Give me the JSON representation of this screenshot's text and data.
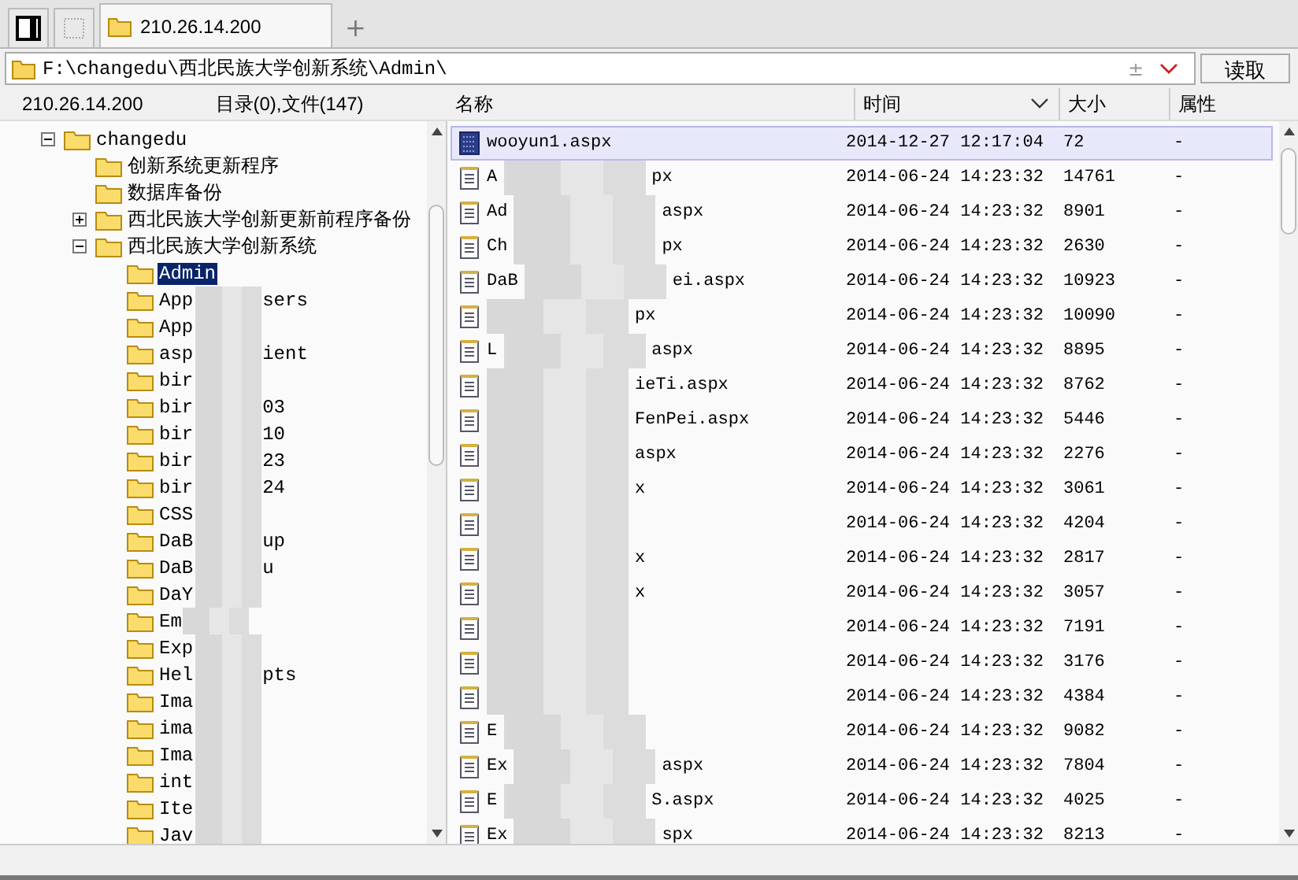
{
  "tabs": [
    {
      "kind": "panel",
      "selected": false
    },
    {
      "kind": "blank",
      "selected": false
    },
    {
      "kind": "folder",
      "label": "210.26.14.200",
      "selected": true
    }
  ],
  "new_tab": "+",
  "address": {
    "value": "F:\\changedu\\西北民族大学创新系统\\Admin\\",
    "extra": "±",
    "button": "读取"
  },
  "left_header": {
    "host": "210.26.14.200",
    "summary": "目录(0),文件(147)"
  },
  "columns": [
    {
      "label": "名称",
      "sorted": false
    },
    {
      "label": "时间",
      "sorted": true
    },
    {
      "label": "大小",
      "sorted": false
    },
    {
      "label": "属性",
      "sorted": false
    }
  ],
  "tree": [
    {
      "name": "changedu",
      "selected": false,
      "expanded": true,
      "children": [
        {
          "name": "创新系统更新程序",
          "selected": false
        },
        {
          "name": "数据库备份",
          "selected": false
        },
        {
          "name": "西北民族大学创新更新前程序备份",
          "selected": false,
          "expanded": false
        },
        {
          "name": "西北民族大学创新系统",
          "selected": false,
          "expanded": true,
          "children": [
            {
              "name": "Admin",
              "selected": true,
              "redacted": false
            },
            {
              "name": "App",
              "name_end": "sers",
              "selected": false,
              "redacted": true
            },
            {
              "name": "App",
              "selected": false,
              "redacted": true
            },
            {
              "name": "asp",
              "name_end": "ient",
              "selected": false,
              "redacted": true
            },
            {
              "name": "bir",
              "selected": false,
              "redacted": true
            },
            {
              "name": "bir",
              "name_end": "03",
              "selected": false,
              "redacted": true
            },
            {
              "name": "bir",
              "name_end": "10",
              "selected": false,
              "redacted": true
            },
            {
              "name": "bir",
              "name_end": "23",
              "selected": false,
              "redacted": true
            },
            {
              "name": "bir",
              "name_end": "24",
              "selected": false,
              "redacted": true
            },
            {
              "name": "CSS",
              "selected": false,
              "redacted": true
            },
            {
              "name": "DaB",
              "name_end": "up",
              "selected": false,
              "redacted": true
            },
            {
              "name": "DaB",
              "name_end": "u",
              "selected": false,
              "redacted": true
            },
            {
              "name": "DaY",
              "selected": false,
              "redacted": true
            },
            {
              "name": "Em",
              "selected": false,
              "redacted": true
            },
            {
              "name": "Exp",
              "selected": false,
              "redacted": true
            },
            {
              "name": "Hel",
              "name_end": "pts",
              "selected": false,
              "redacted": true
            },
            {
              "name": "Ima",
              "selected": false,
              "redacted": true
            },
            {
              "name": "ima",
              "selected": false,
              "redacted": true
            },
            {
              "name": "Ima",
              "selected": false,
              "redacted": true
            },
            {
              "name": "int",
              "selected": false,
              "redacted": true
            },
            {
              "name": "Ite",
              "selected": false,
              "redacted": true
            },
            {
              "name": "Jav",
              "selected": false,
              "redacted": true
            }
          ]
        }
      ]
    }
  ],
  "files": [
    {
      "kind": "special",
      "name": "wooyun1.aspx",
      "redacted": false,
      "selected": true,
      "time": "2014-12-27 12:17:04",
      "size": "72",
      "attr": "-"
    },
    {
      "kind": "text",
      "name": "A",
      "name_end": "px",
      "redacted": true,
      "selected": false,
      "time": "2014-06-24 14:23:32",
      "size": "14761",
      "attr": "-"
    },
    {
      "kind": "text",
      "name": "Ad",
      "name_end": "aspx",
      "redacted": true,
      "selected": false,
      "time": "2014-06-24 14:23:32",
      "size": "8901",
      "attr": "-"
    },
    {
      "kind": "text",
      "name": "Ch",
      "name_end": "px",
      "redacted": true,
      "selected": false,
      "time": "2014-06-24 14:23:32",
      "size": "2630",
      "attr": "-"
    },
    {
      "kind": "text",
      "name": "DaB",
      "name_end": "ei.aspx",
      "redacted": true,
      "selected": false,
      "time": "2014-06-24 14:23:32",
      "size": "10923",
      "attr": "-"
    },
    {
      "kind": "text",
      "name_end": "px",
      "redacted": true,
      "selected": false,
      "time": "2014-06-24 14:23:32",
      "size": "10090",
      "attr": "-"
    },
    {
      "kind": "text",
      "name": "L",
      "name_end": "aspx",
      "redacted": true,
      "selected": false,
      "time": "2014-06-24 14:23:32",
      "size": "8895",
      "attr": "-"
    },
    {
      "kind": "text",
      "name_end": "ieTi.aspx",
      "redacted": true,
      "selected": false,
      "time": "2014-06-24 14:23:32",
      "size": "8762",
      "attr": "-"
    },
    {
      "kind": "text",
      "name_end": "FenPei.aspx",
      "redacted": true,
      "selected": false,
      "time": "2014-06-24 14:23:32",
      "size": "5446",
      "attr": "-"
    },
    {
      "kind": "text",
      "name_end": "aspx",
      "redacted": true,
      "selected": false,
      "time": "2014-06-24 14:23:32",
      "size": "2276",
      "attr": "-"
    },
    {
      "kind": "text",
      "name_end": "x",
      "redacted": true,
      "selected": false,
      "time": "2014-06-24 14:23:32",
      "size": "3061",
      "attr": "-"
    },
    {
      "kind": "text",
      "redacted": true,
      "selected": false,
      "time": "2014-06-24 14:23:32",
      "size": "4204",
      "attr": "-"
    },
    {
      "kind": "text",
      "name_end": "x",
      "redacted": true,
      "selected": false,
      "time": "2014-06-24 14:23:32",
      "size": "2817",
      "attr": "-"
    },
    {
      "kind": "text",
      "name_end": "x",
      "redacted": true,
      "selected": false,
      "time": "2014-06-24 14:23:32",
      "size": "3057",
      "attr": "-"
    },
    {
      "kind": "text",
      "redacted": true,
      "selected": false,
      "time": "2014-06-24 14:23:32",
      "size": "7191",
      "attr": "-"
    },
    {
      "kind": "text",
      "redacted": true,
      "selected": false,
      "time": "2014-06-24 14:23:32",
      "size": "3176",
      "attr": "-"
    },
    {
      "kind": "text",
      "redacted": true,
      "selected": false,
      "time": "2014-06-24 14:23:32",
      "size": "4384",
      "attr": "-"
    },
    {
      "kind": "text",
      "name": "E",
      "redacted": true,
      "selected": false,
      "time": "2014-06-24 14:23:32",
      "size": "9082",
      "attr": "-"
    },
    {
      "kind": "text",
      "name": "Ex",
      "name_end": "aspx",
      "redacted": true,
      "selected": false,
      "time": "2014-06-24 14:23:32",
      "size": "7804",
      "attr": "-"
    },
    {
      "kind": "text",
      "name": "E",
      "name_end": "S.aspx",
      "redacted": true,
      "selected": false,
      "time": "2014-06-24 14:23:32",
      "size": "4025",
      "attr": "-"
    },
    {
      "kind": "text",
      "name": "Ex",
      "name_end": "spx",
      "redacted": true,
      "selected": false,
      "time": "2014-06-24 14:23:32",
      "size": "8213",
      "attr": "-"
    }
  ]
}
